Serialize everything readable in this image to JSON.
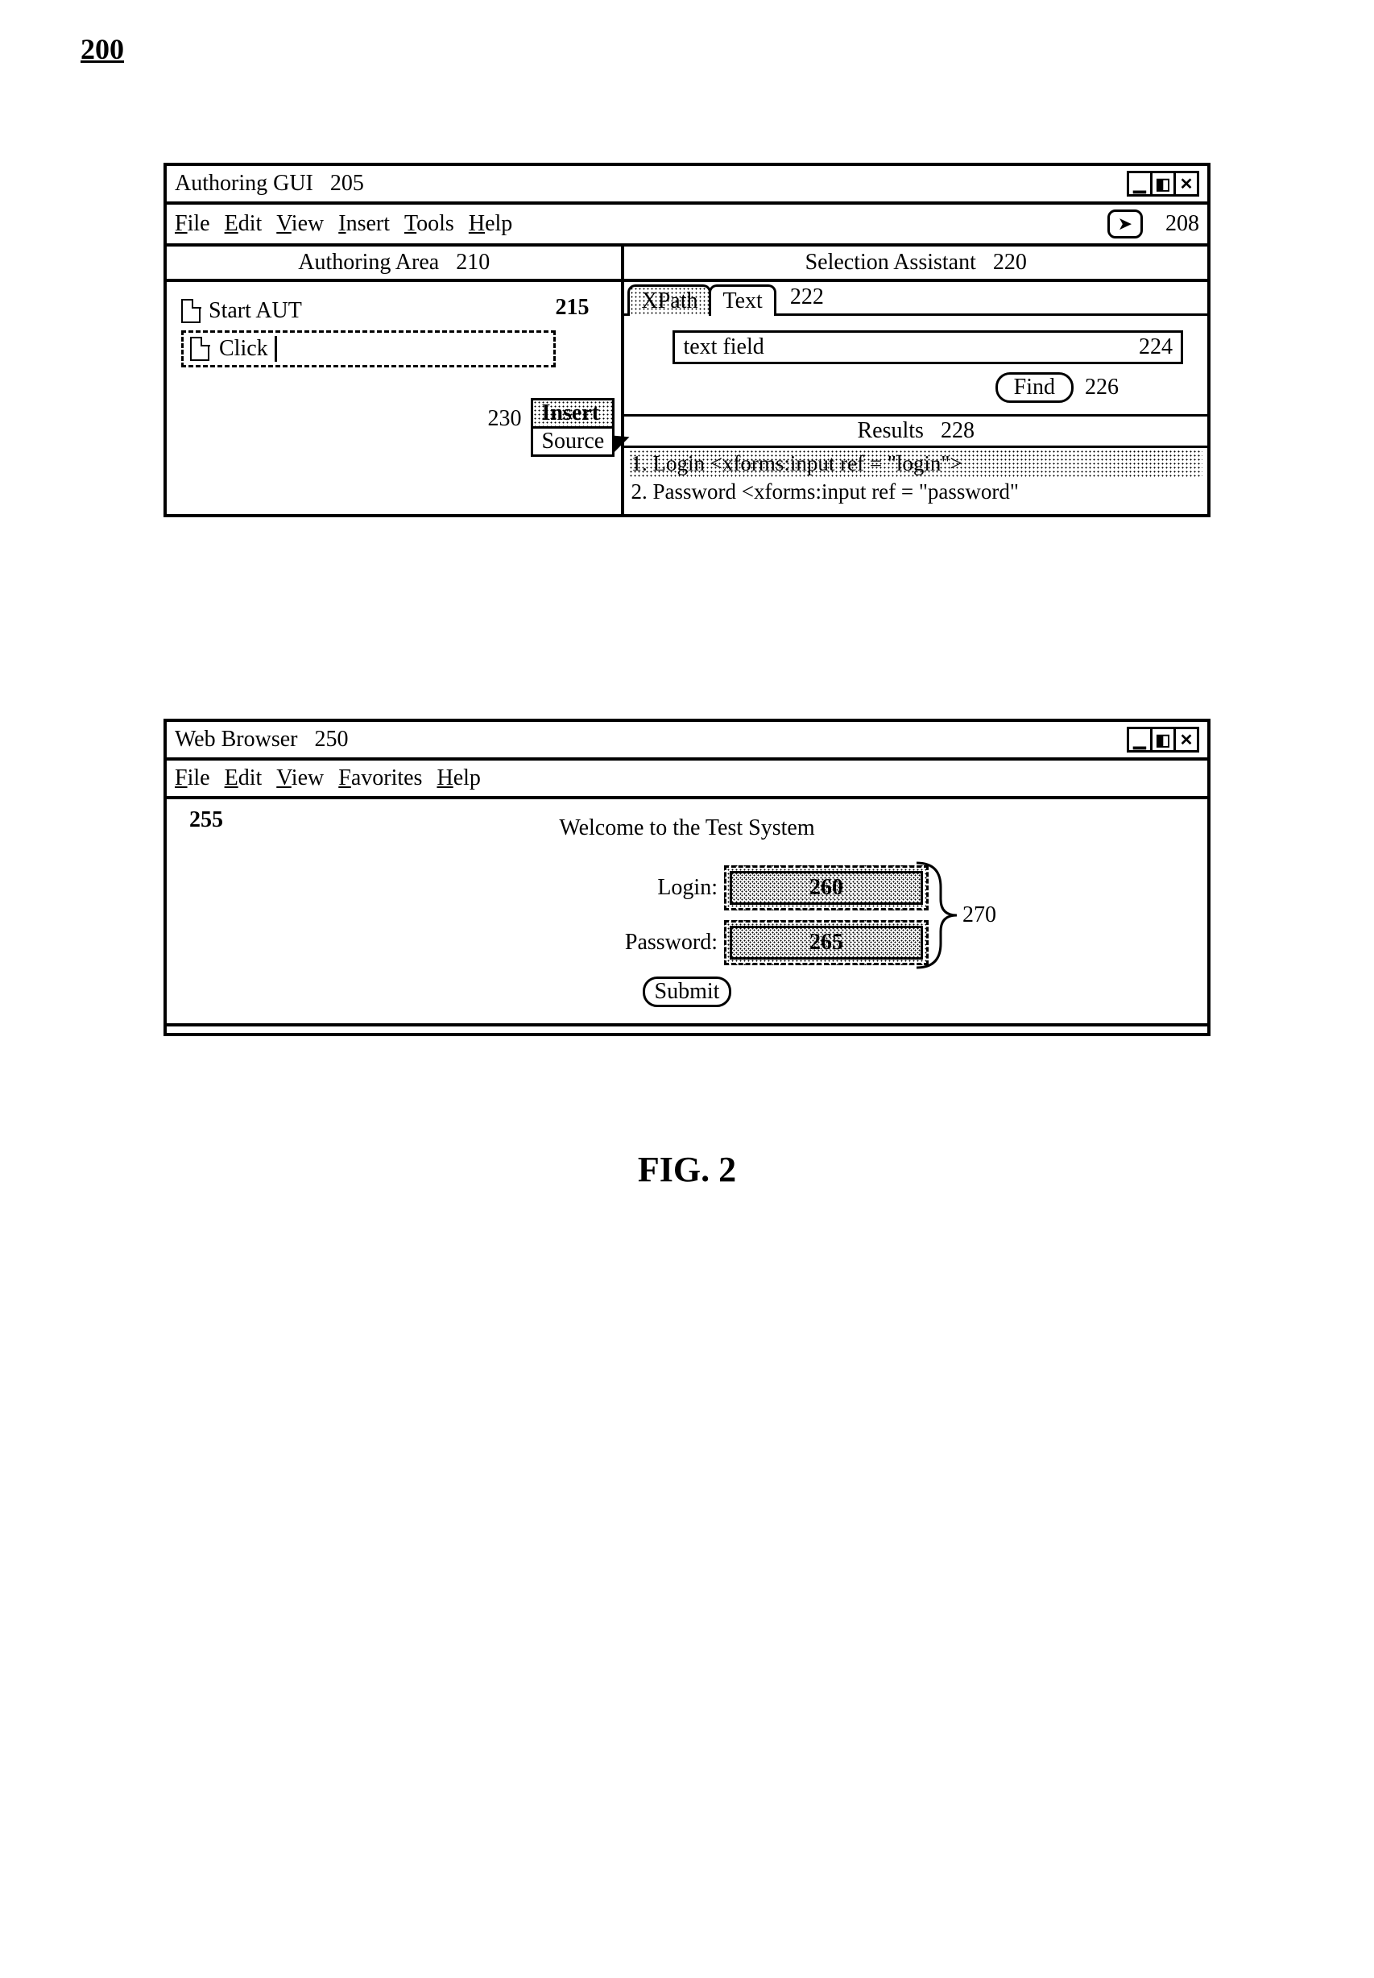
{
  "figure_number_top": "200",
  "window1": {
    "title": "Authoring GUI",
    "title_ref": "205",
    "menus": [
      "File",
      "Edit",
      "View",
      "Insert",
      "Tools",
      "Help"
    ],
    "cursor_ref": "208",
    "pane_left_header": "Authoring Area",
    "pane_left_ref": "210",
    "step1": "Start AUT",
    "step2": "Click",
    "step_ref": "215",
    "pane_right_header": "Selection Assistant",
    "pane_right_ref": "220",
    "tab_xpath": "XPath",
    "tab_text": "Text",
    "tabs_ref": "222",
    "text_field_label": "text field",
    "text_field_ref": "224",
    "find_label": "Find",
    "find_ref": "226",
    "results_header": "Results",
    "results_ref": "228",
    "result1": "1. Login  <xforms:input ref = \"login\">",
    "result2": "2. Password  <xforms:input ref = \"password\"",
    "ctx_insert": "Insert",
    "ctx_source": "Source",
    "ctx_ref": "230"
  },
  "window2": {
    "title": "Web Browser",
    "title_ref": "250",
    "menus": [
      "File",
      "Edit",
      "View",
      "Favorites",
      "Help"
    ],
    "body_ref": "255",
    "welcome": "Welcome to the Test System",
    "login_label": "Login:",
    "login_ref": "260",
    "password_label": "Password:",
    "password_ref": "265",
    "group_ref": "270",
    "submit_label": "Submit"
  },
  "figure_caption": "FIG. 2"
}
